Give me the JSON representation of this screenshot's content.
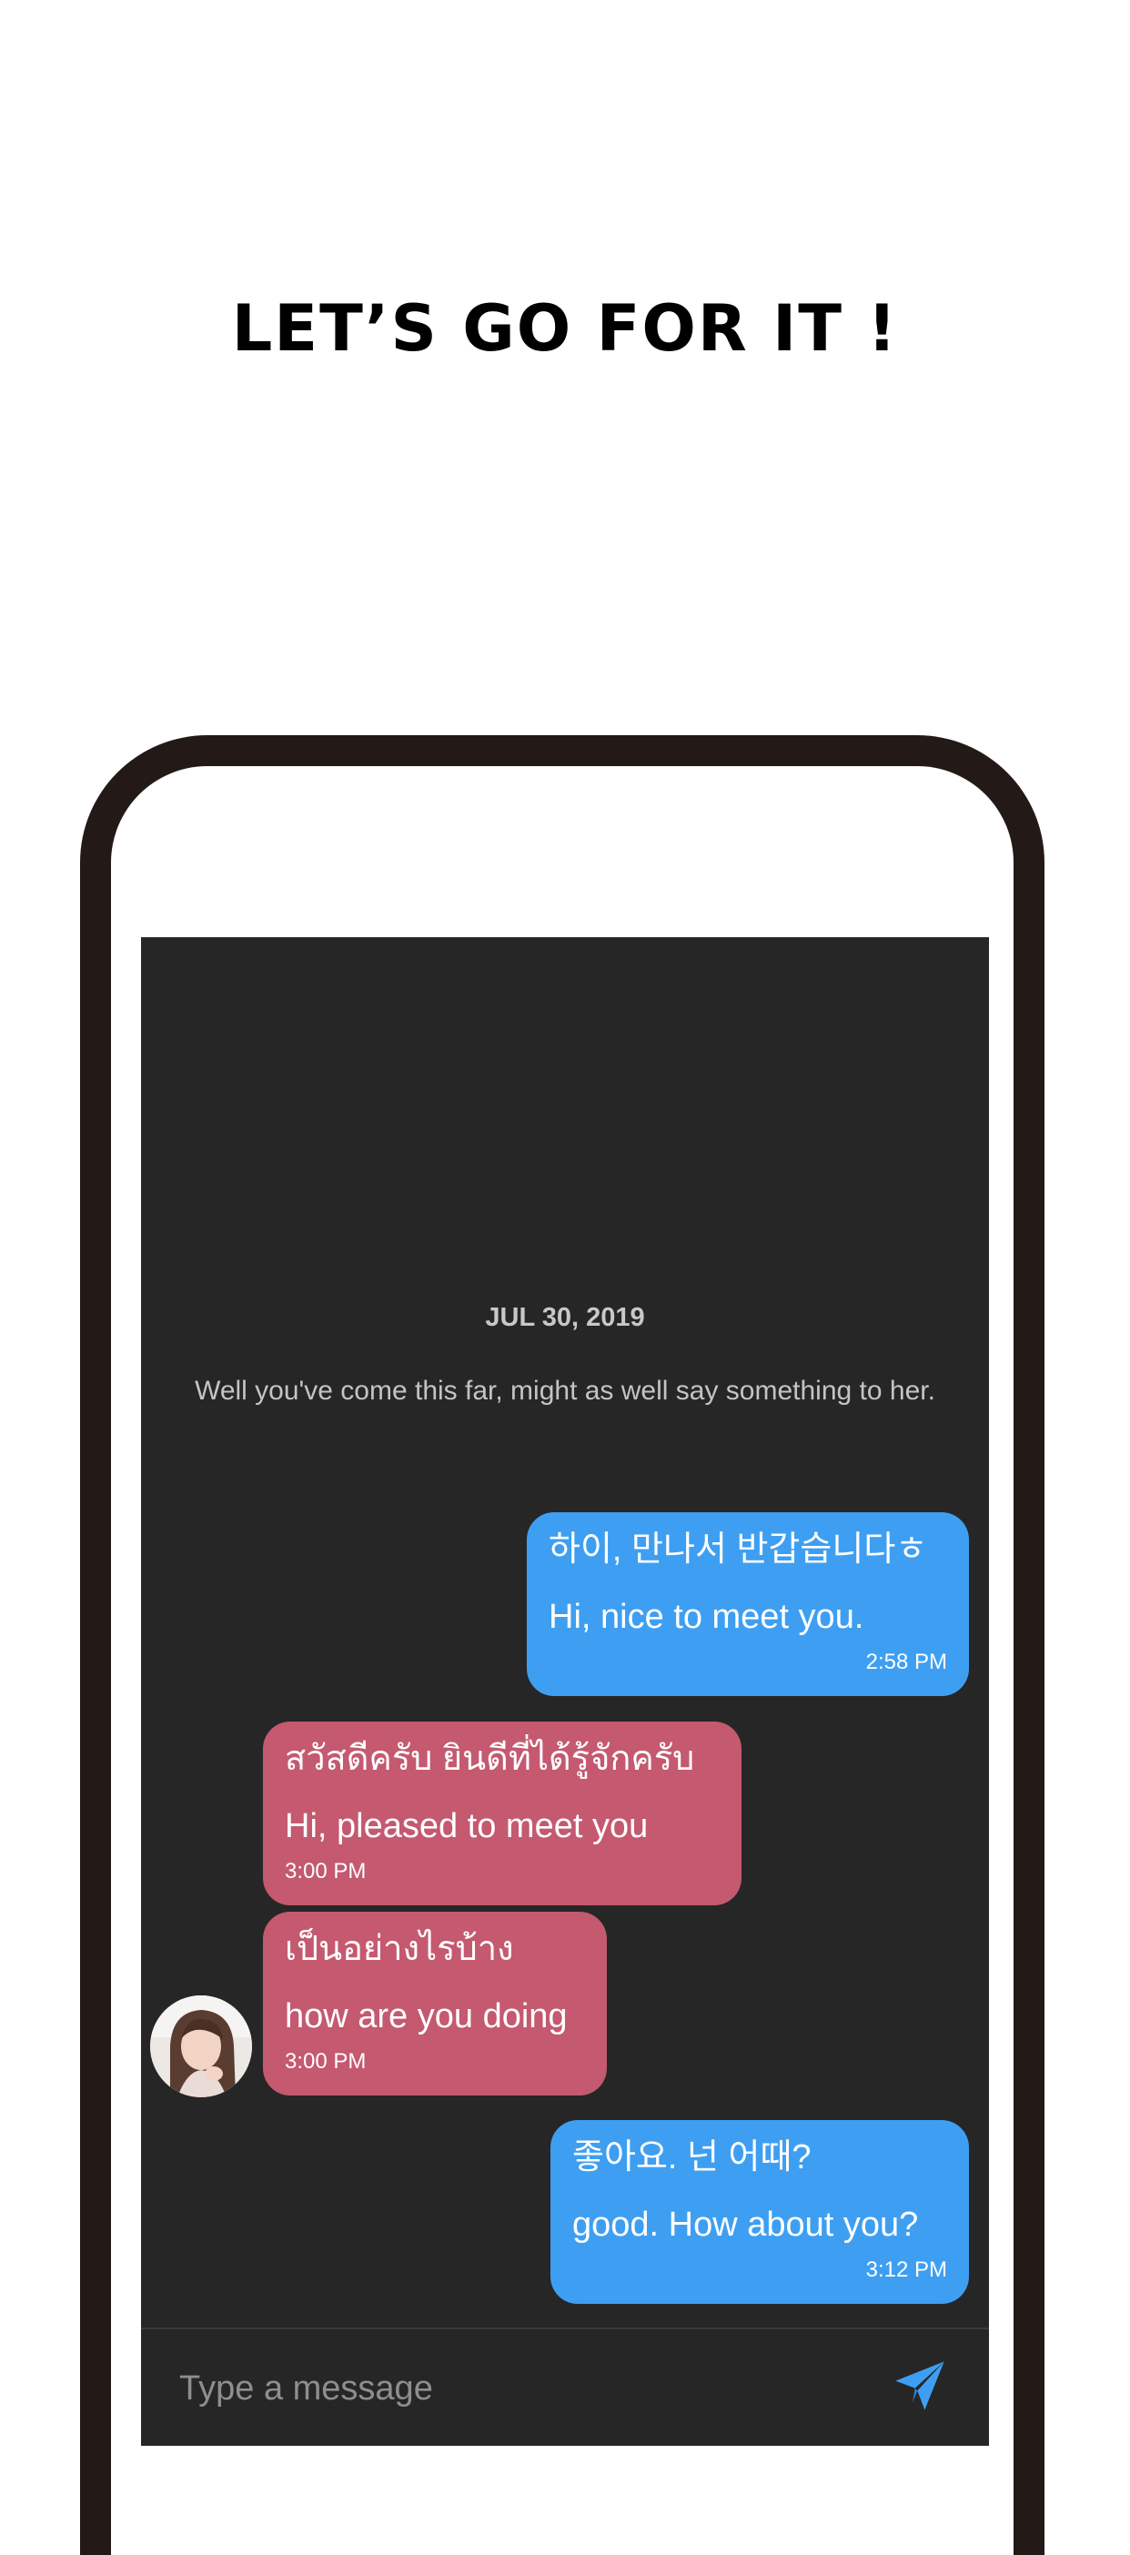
{
  "headline": "LET’S GO FOR IT !",
  "chat": {
    "date": "JUL 30, 2019",
    "notice": "Well you've come this far, might as well say something to her.",
    "messages": [
      {
        "type": "sent",
        "original": "하이, 만나서 반갑습니다ㅎ",
        "translation": "Hi, nice to meet you.",
        "time": "2:58 PM"
      },
      {
        "type": "received",
        "original": "สวัสดีครับ ยินดีที่ได้รู้จักครับ",
        "translation": "Hi, pleased to meet you",
        "time": "3:00 PM"
      },
      {
        "type": "received",
        "original": "เป็นอย่างไรบ้าง",
        "translation": "how are you doing",
        "time": "3:00 PM"
      },
      {
        "type": "sent",
        "original": "좋아요. 넌 어때?",
        "translation": "good. How about you?",
        "time": "3:12 PM"
      }
    ]
  },
  "input": {
    "placeholder": "Type a message",
    "send_icon": "send-icon"
  },
  "colors": {
    "sent_bubble": "#3e9ff2",
    "received_bubble": "#c45970",
    "screen_background": "#262626",
    "phone_frame": "#231a18"
  }
}
